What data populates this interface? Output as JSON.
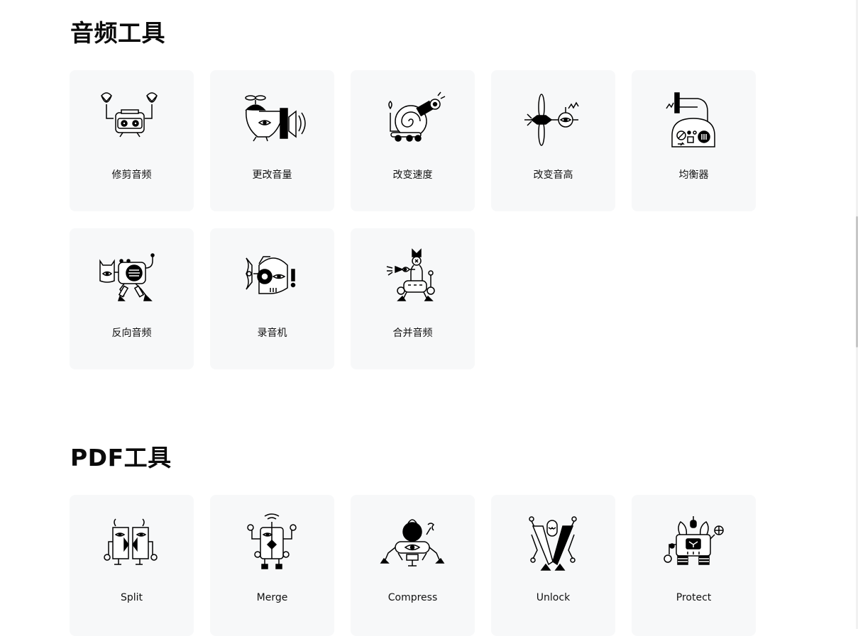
{
  "audio_section": {
    "title": "音频工具",
    "tools": [
      {
        "label": "修剪音频",
        "icon": "crab-cassette-robot-icon"
      },
      {
        "label": "更改音量",
        "icon": "propeller-bird-speaker-icon"
      },
      {
        "label": "改变速度",
        "icon": "snail-robot-icon"
      },
      {
        "label": "改变音高",
        "icon": "dragonfly-robot-icon"
      },
      {
        "label": "均衡器",
        "icon": "gramophone-robot-icon"
      },
      {
        "label": "反向音频",
        "icon": "walking-speaker-robot-icon"
      },
      {
        "label": "录音机",
        "icon": "fish-microphone-robot-icon"
      },
      {
        "label": "合并音频",
        "icon": "periscope-robot-icon"
      }
    ]
  },
  "pdf_section": {
    "title": "PDF工具",
    "tools": [
      {
        "label": "Split",
        "icon": "split-robot-icon"
      },
      {
        "label": "Merge",
        "icon": "merge-robot-icon"
      },
      {
        "label": "Compress",
        "icon": "kettlebell-spider-robot-icon"
      },
      {
        "label": "Unlock",
        "icon": "pliers-robot-icon"
      },
      {
        "label": "Protect",
        "icon": "rabbit-lock-robot-icon"
      }
    ]
  }
}
